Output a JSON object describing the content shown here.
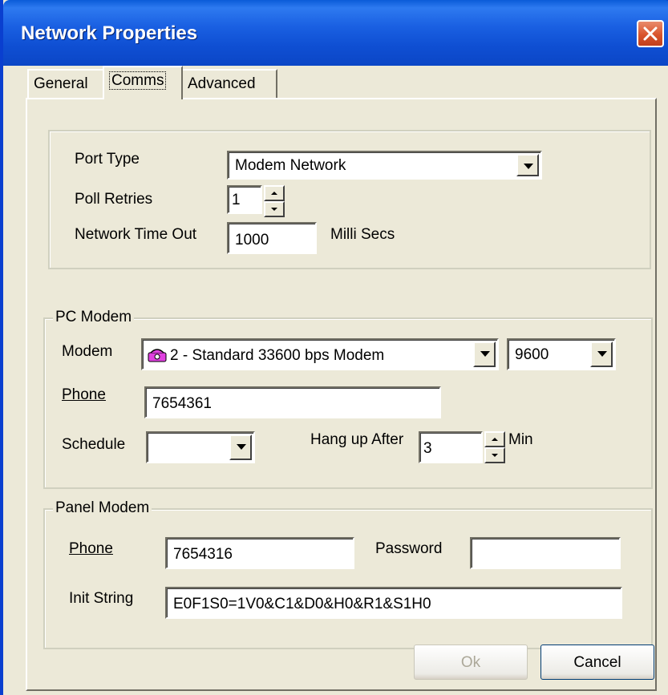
{
  "window": {
    "title": "Network Properties"
  },
  "tabs": [
    {
      "label": "General"
    },
    {
      "label": "Comms"
    },
    {
      "label": "Advanced"
    }
  ],
  "port": {
    "port_type_label": "Port Type",
    "port_type_value": "Modem Network",
    "poll_retries_label": "Poll Retries",
    "poll_retries_value": "1",
    "timeout_label": "Network Time Out",
    "timeout_value": "1000",
    "timeout_unit": "Milli Secs"
  },
  "pc_modem": {
    "legend": "PC Modem",
    "modem_label": "Modem",
    "modem_value": "2 - Standard 33600 bps Modem",
    "modem_icon": "modem-phone-icon",
    "baud_value": "9600",
    "phone_label": "Phone",
    "phone_value": "7654361",
    "schedule_label": "Schedule",
    "schedule_value": "",
    "hangup_label": "Hang up After",
    "hangup_value": "3",
    "hangup_unit": "Min"
  },
  "panel_modem": {
    "legend": "Panel Modem",
    "phone_label": "Phone",
    "phone_value": "7654316",
    "password_label": "Password",
    "password_value": "",
    "init_label": "Init String",
    "init_value": "E0F1S0=1V0&C1&D0&H0&R1&S1H0"
  },
  "buttons": {
    "ok": "Ok",
    "cancel": "Cancel"
  },
  "colors": {
    "titlebar": "#0f4fd3",
    "close": "#d9542c",
    "face": "#ece9d8"
  }
}
